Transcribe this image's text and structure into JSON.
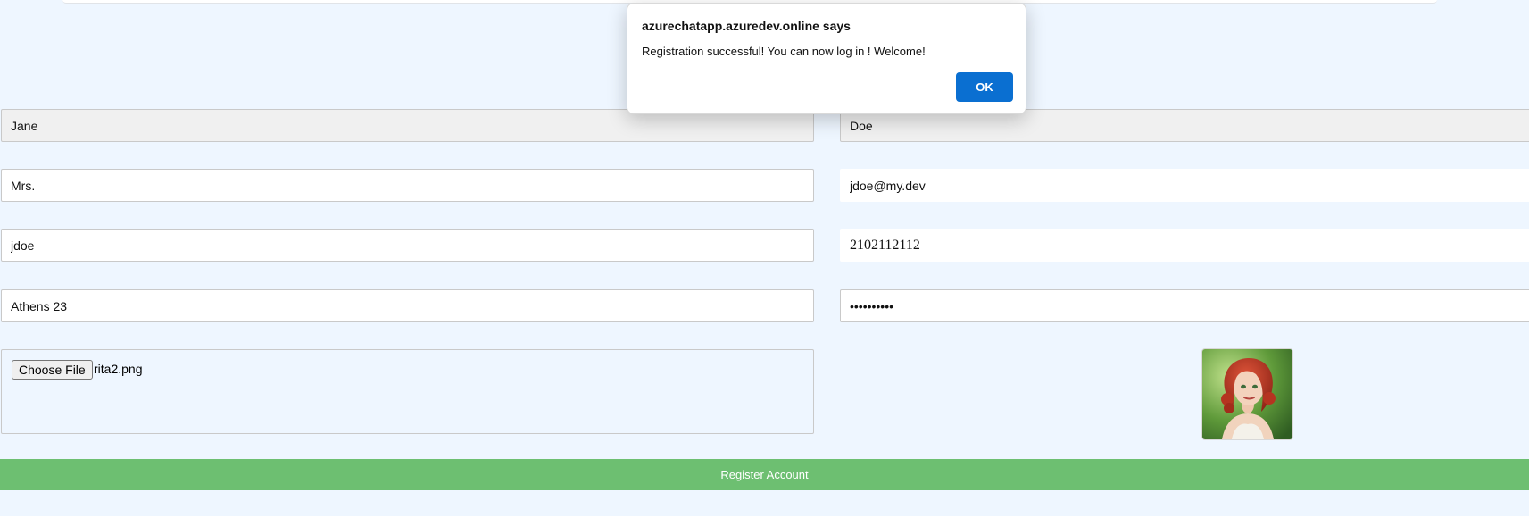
{
  "dialog": {
    "title": "azurechatapp.azuredev.online says",
    "message": "Registration successful! You can now log in ! Welcome!",
    "ok_label": "OK"
  },
  "form": {
    "first_name": "Jane",
    "last_name": "Doe",
    "title": "Mrs.",
    "email": "jdoe@my.dev",
    "username": "jdoe",
    "phone": "2102112112",
    "address": "Athens 23",
    "password": "••••••••••",
    "choose_file_label": "Choose File",
    "file_name": "rita2.png",
    "register_label": "Register Account"
  },
  "colors": {
    "page_background": "#eef6ff",
    "register_button": "#6dbf71",
    "ok_button": "#0a6fd1"
  }
}
